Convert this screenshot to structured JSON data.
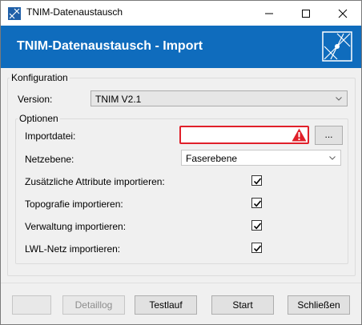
{
  "window": {
    "title": "TNIM-Datenaustausch"
  },
  "banner": {
    "title": "TNIM-Datenaustausch - Import",
    "background": "#0f6cbd"
  },
  "config": {
    "group_label": "Konfiguration",
    "version_label": "Version:",
    "version_value": "TNIM V2.1"
  },
  "options": {
    "group_label": "Optionen",
    "importfile_label": "Importdatei:",
    "importfile_value": "",
    "importfile_state": "error",
    "browse_label": "...",
    "netlevel_label": "Netzebene:",
    "netlevel_value": "Faserebene",
    "checks": [
      {
        "label": "Zusätzliche Attribute importieren:",
        "checked": true
      },
      {
        "label": "Topografie importieren:",
        "checked": true
      },
      {
        "label": "Verwaltung importieren:",
        "checked": true
      },
      {
        "label": "LWL-Netz importieren:",
        "checked": true
      }
    ]
  },
  "footer": {
    "blank_label": "",
    "detaillog_label": "Detaillog",
    "testlauf_label": "Testlauf",
    "start_label": "Start",
    "close_label": "Schließen"
  },
  "colors": {
    "error": "#e0202a",
    "accent": "#0f6cbd"
  }
}
